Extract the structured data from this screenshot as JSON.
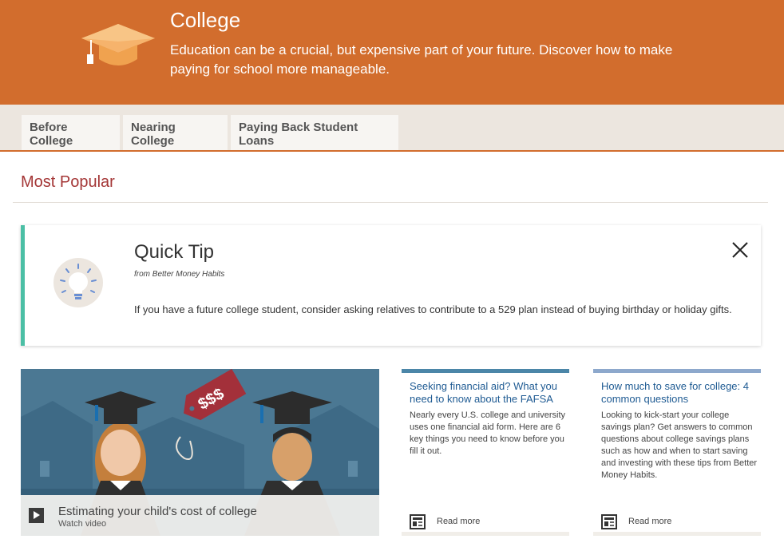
{
  "hero": {
    "title": "College",
    "description": "Education can be a crucial, but expensive part of your future. Discover how to make paying for school more manageable.",
    "icon": "graduation-cap-icon",
    "background_color": "#d26d2d"
  },
  "tabs": [
    {
      "label": "Before College"
    },
    {
      "label": "Nearing College"
    },
    {
      "label": "Paying Back Student Loans"
    }
  ],
  "section": {
    "title": "Most Popular"
  },
  "quick_tip": {
    "title": "Quick Tip",
    "source": "from Better Money Habits",
    "body": "If you have a future college student, consider asking relatives to contribute to a 529 plan instead of buying birthday or holiday gifts.",
    "icon": "lightbulb-icon",
    "accent_color": "#4bbfa5"
  },
  "video": {
    "title": "Estimating your child's cost of college",
    "subtitle": "Watch video",
    "price_tag": "$$$"
  },
  "cards": [
    {
      "title": "Seeking financial aid? What you need to know about the FAFSA",
      "body": "Nearly every U.S. college and university uses one financial aid form. Here are 6 key things you need to know before you fill it out.",
      "read_more": "Read more",
      "accent_color": "#4b86a8"
    },
    {
      "title": "How much to save for college: 4 common questions",
      "body": "Looking to kick-start your college savings plan? Get answers to common questions about college savings plans such as how and when to start saving and investing with these tips from Better Money Habits.",
      "read_more": "Read more",
      "accent_color": "#8da8cc"
    }
  ]
}
